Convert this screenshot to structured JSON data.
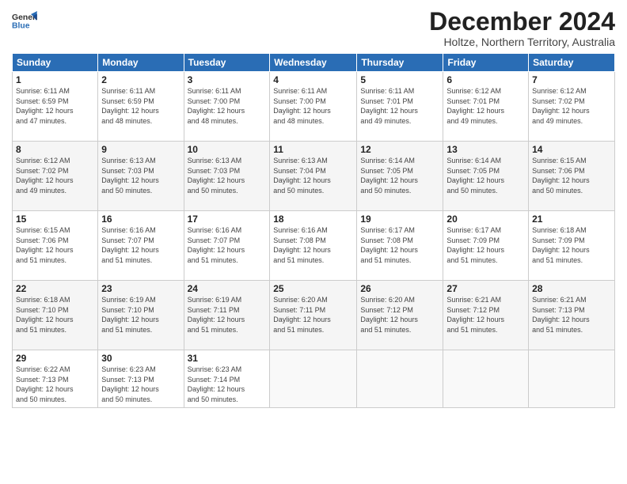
{
  "header": {
    "logo_line1": "General",
    "logo_line2": "Blue",
    "month": "December 2024",
    "location": "Holtze, Northern Territory, Australia"
  },
  "weekdays": [
    "Sunday",
    "Monday",
    "Tuesday",
    "Wednesday",
    "Thursday",
    "Friday",
    "Saturday"
  ],
  "weeks": [
    [
      {
        "day": "1",
        "info": "Sunrise: 6:11 AM\nSunset: 6:59 PM\nDaylight: 12 hours\nand 47 minutes."
      },
      {
        "day": "2",
        "info": "Sunrise: 6:11 AM\nSunset: 6:59 PM\nDaylight: 12 hours\nand 48 minutes."
      },
      {
        "day": "3",
        "info": "Sunrise: 6:11 AM\nSunset: 7:00 PM\nDaylight: 12 hours\nand 48 minutes."
      },
      {
        "day": "4",
        "info": "Sunrise: 6:11 AM\nSunset: 7:00 PM\nDaylight: 12 hours\nand 48 minutes."
      },
      {
        "day": "5",
        "info": "Sunrise: 6:11 AM\nSunset: 7:01 PM\nDaylight: 12 hours\nand 49 minutes."
      },
      {
        "day": "6",
        "info": "Sunrise: 6:12 AM\nSunset: 7:01 PM\nDaylight: 12 hours\nand 49 minutes."
      },
      {
        "day": "7",
        "info": "Sunrise: 6:12 AM\nSunset: 7:02 PM\nDaylight: 12 hours\nand 49 minutes."
      }
    ],
    [
      {
        "day": "8",
        "info": "Sunrise: 6:12 AM\nSunset: 7:02 PM\nDaylight: 12 hours\nand 49 minutes."
      },
      {
        "day": "9",
        "info": "Sunrise: 6:13 AM\nSunset: 7:03 PM\nDaylight: 12 hours\nand 50 minutes."
      },
      {
        "day": "10",
        "info": "Sunrise: 6:13 AM\nSunset: 7:03 PM\nDaylight: 12 hours\nand 50 minutes."
      },
      {
        "day": "11",
        "info": "Sunrise: 6:13 AM\nSunset: 7:04 PM\nDaylight: 12 hours\nand 50 minutes."
      },
      {
        "day": "12",
        "info": "Sunrise: 6:14 AM\nSunset: 7:05 PM\nDaylight: 12 hours\nand 50 minutes."
      },
      {
        "day": "13",
        "info": "Sunrise: 6:14 AM\nSunset: 7:05 PM\nDaylight: 12 hours\nand 50 minutes."
      },
      {
        "day": "14",
        "info": "Sunrise: 6:15 AM\nSunset: 7:06 PM\nDaylight: 12 hours\nand 50 minutes."
      }
    ],
    [
      {
        "day": "15",
        "info": "Sunrise: 6:15 AM\nSunset: 7:06 PM\nDaylight: 12 hours\nand 51 minutes."
      },
      {
        "day": "16",
        "info": "Sunrise: 6:16 AM\nSunset: 7:07 PM\nDaylight: 12 hours\nand 51 minutes."
      },
      {
        "day": "17",
        "info": "Sunrise: 6:16 AM\nSunset: 7:07 PM\nDaylight: 12 hours\nand 51 minutes."
      },
      {
        "day": "18",
        "info": "Sunrise: 6:16 AM\nSunset: 7:08 PM\nDaylight: 12 hours\nand 51 minutes."
      },
      {
        "day": "19",
        "info": "Sunrise: 6:17 AM\nSunset: 7:08 PM\nDaylight: 12 hours\nand 51 minutes."
      },
      {
        "day": "20",
        "info": "Sunrise: 6:17 AM\nSunset: 7:09 PM\nDaylight: 12 hours\nand 51 minutes."
      },
      {
        "day": "21",
        "info": "Sunrise: 6:18 AM\nSunset: 7:09 PM\nDaylight: 12 hours\nand 51 minutes."
      }
    ],
    [
      {
        "day": "22",
        "info": "Sunrise: 6:18 AM\nSunset: 7:10 PM\nDaylight: 12 hours\nand 51 minutes."
      },
      {
        "day": "23",
        "info": "Sunrise: 6:19 AM\nSunset: 7:10 PM\nDaylight: 12 hours\nand 51 minutes."
      },
      {
        "day": "24",
        "info": "Sunrise: 6:19 AM\nSunset: 7:11 PM\nDaylight: 12 hours\nand 51 minutes."
      },
      {
        "day": "25",
        "info": "Sunrise: 6:20 AM\nSunset: 7:11 PM\nDaylight: 12 hours\nand 51 minutes."
      },
      {
        "day": "26",
        "info": "Sunrise: 6:20 AM\nSunset: 7:12 PM\nDaylight: 12 hours\nand 51 minutes."
      },
      {
        "day": "27",
        "info": "Sunrise: 6:21 AM\nSunset: 7:12 PM\nDaylight: 12 hours\nand 51 minutes."
      },
      {
        "day": "28",
        "info": "Sunrise: 6:21 AM\nSunset: 7:13 PM\nDaylight: 12 hours\nand 51 minutes."
      }
    ],
    [
      {
        "day": "29",
        "info": "Sunrise: 6:22 AM\nSunset: 7:13 PM\nDaylight: 12 hours\nand 50 minutes."
      },
      {
        "day": "30",
        "info": "Sunrise: 6:23 AM\nSunset: 7:13 PM\nDaylight: 12 hours\nand 50 minutes."
      },
      {
        "day": "31",
        "info": "Sunrise: 6:23 AM\nSunset: 7:14 PM\nDaylight: 12 hours\nand 50 minutes."
      },
      {
        "day": "",
        "info": ""
      },
      {
        "day": "",
        "info": ""
      },
      {
        "day": "",
        "info": ""
      },
      {
        "day": "",
        "info": ""
      }
    ]
  ]
}
